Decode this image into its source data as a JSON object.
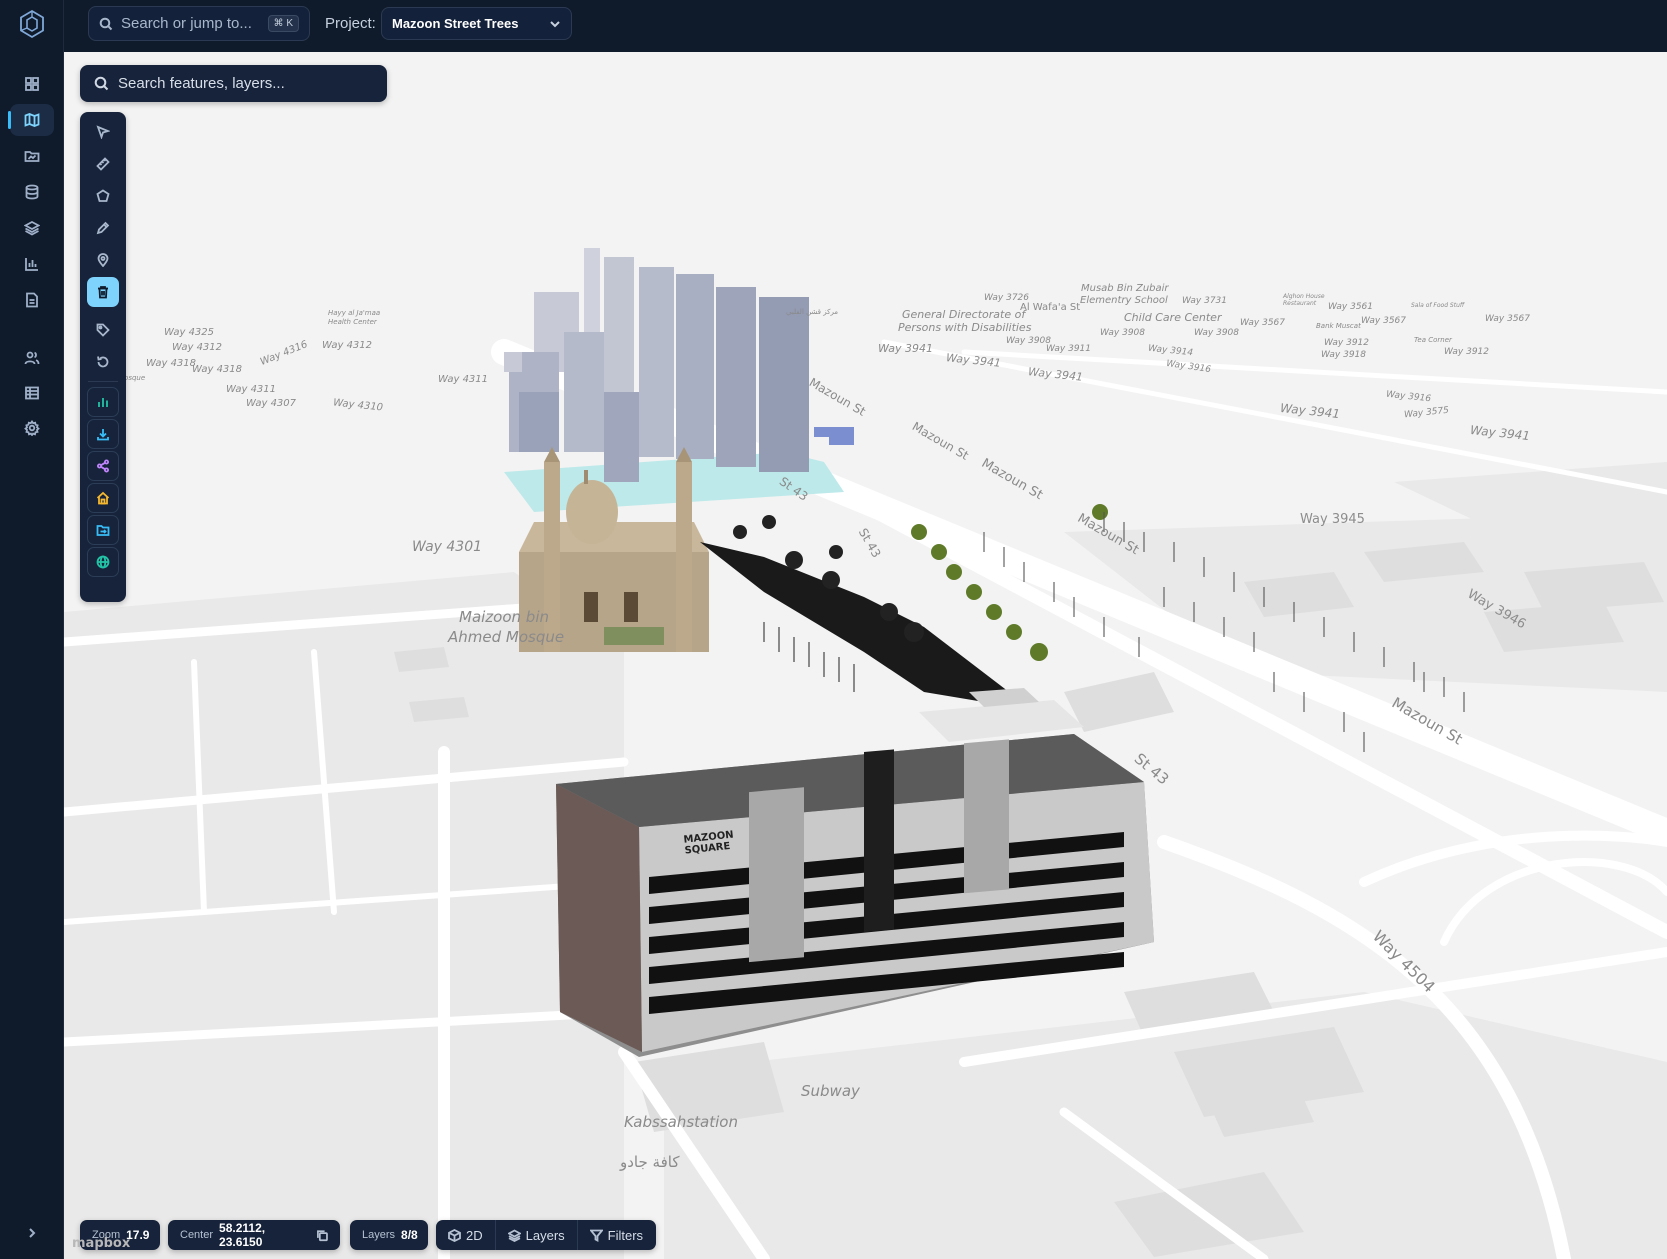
{
  "topbar": {
    "search_placeholder": "Search or jump to...",
    "search_shortcut": "⌘ K",
    "project_label": "Project:",
    "project_value": "Mazoon Street Trees"
  },
  "sidebar": {
    "items": [
      {
        "icon": "dashboard-icon"
      },
      {
        "icon": "map-icon",
        "active": true
      },
      {
        "icon": "folder-map-icon"
      },
      {
        "icon": "database-icon"
      },
      {
        "icon": "layers-icon"
      },
      {
        "icon": "chart-icon"
      },
      {
        "icon": "document-icon"
      },
      {
        "icon": "users-icon"
      },
      {
        "icon": "table-icon"
      },
      {
        "icon": "settings-icon"
      }
    ]
  },
  "map_search": {
    "placeholder": "Search features, layers..."
  },
  "tools": [
    {
      "icon": "pointer-icon"
    },
    {
      "icon": "ruler-icon"
    },
    {
      "icon": "polygon-icon"
    },
    {
      "icon": "pen-icon"
    },
    {
      "icon": "pin-icon"
    },
    {
      "icon": "trash-icon",
      "active": true
    },
    {
      "icon": "tag-icon"
    },
    {
      "icon": "reset-icon"
    },
    {
      "icon": "bar-chart-icon",
      "color": "#22c3a6"
    },
    {
      "icon": "download-icon",
      "color": "#38bdf8"
    },
    {
      "icon": "share-icon",
      "color": "#c084fc"
    },
    {
      "icon": "home-icon",
      "color": "#f5b82e"
    },
    {
      "icon": "folder-open-icon",
      "color": "#38bdf8"
    },
    {
      "icon": "globe-icon",
      "color": "#22c3a6"
    }
  ],
  "status": {
    "zoom_label": "Zoom",
    "zoom_value": "17.9",
    "center_label": "Center",
    "center_value": "58.2112, 23.6150",
    "layers_label": "Layers",
    "layers_value": "8/8",
    "view_mode": "2D",
    "layers_button": "Layers",
    "filters_button": "Filters"
  },
  "map_labels": {
    "streets": [
      "Way 4325",
      "Way 4312",
      "Way 4316",
      "Way 4318",
      "Way 4318",
      "Way 4312",
      "Way 4311",
      "Way 4311",
      "Way 4307",
      "Way 4310",
      "Way 4301",
      "Way 3726",
      "Al Wafa'a St",
      "Way 3731",
      "Way 3561",
      "Way 3567",
      "Way 3567",
      "Way 3567",
      "Way 3908",
      "Way 3908",
      "Way 3911",
      "Way 3908",
      "Way 3914",
      "Way 3912",
      "Way 3941",
      "Way 3941",
      "Way 3941",
      "Way 3916",
      "Way 3918",
      "Way 3912",
      "Way 3916",
      "Way 3941",
      "Way 3575",
      "Way 3941",
      "Way 3945",
      "Way 3946",
      "Mazoun St",
      "Mazoun St",
      "Mazoun St",
      "Mazoun St",
      "Mazoun St",
      "St 43",
      "St 43",
      "St 43",
      "Way 4504"
    ],
    "places": [
      "Hayy al Ja'maa Health Center",
      "General Directorate of",
      "Persons with Disabilities",
      "Musab Bin Zubair",
      "Elementry School",
      "Child Care Center",
      "Alghon House Restaurant",
      "Bank Muscat",
      "Tea Corner",
      "Sala of Food Stuff",
      "Maizoon bin",
      "Ahmed Mosque",
      "Subway",
      "Kabssahstation",
      "كافة جادو",
      "مركز قشن الفلبي",
      "Mosque"
    ],
    "building_sign": "MAZOON SQUARE"
  },
  "attribution": "mapbox"
}
